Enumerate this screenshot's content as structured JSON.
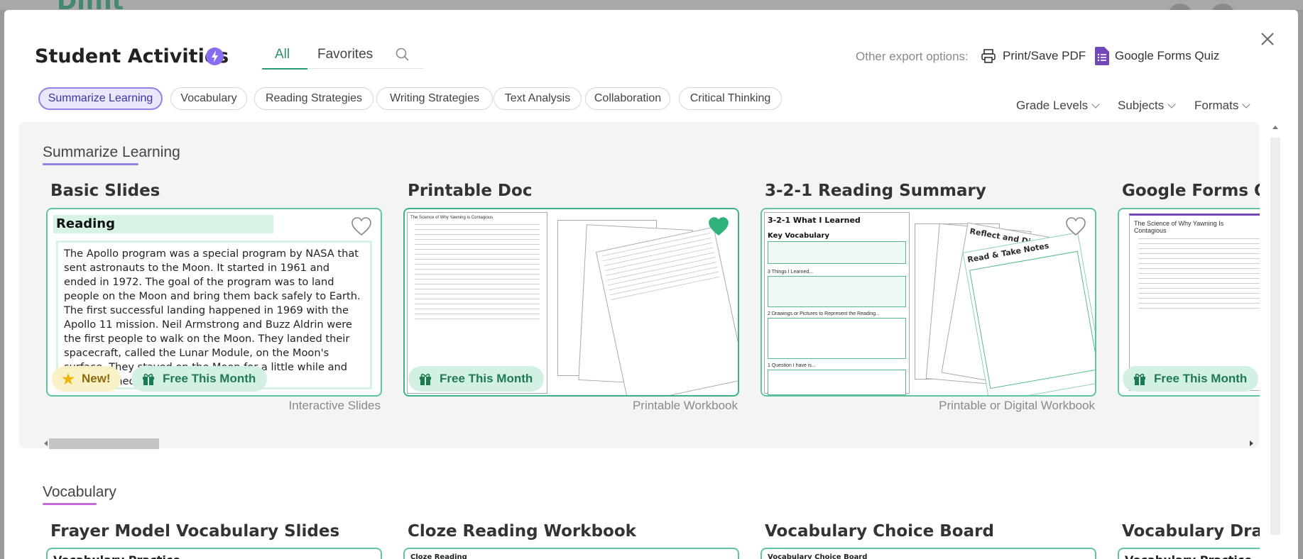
{
  "background": {
    "logo_text": "Diffit"
  },
  "header": {
    "title": "Student Activities",
    "tabs": [
      {
        "label": "All"
      },
      {
        "label": "Favorites"
      }
    ],
    "export": {
      "label": "Other export options:",
      "options": [
        {
          "label": "Print/Save PDF"
        },
        {
          "label": "Google Forms Quiz"
        }
      ]
    }
  },
  "categories": [
    {
      "label": "Summarize Learning"
    },
    {
      "label": "Vocabulary"
    },
    {
      "label": "Reading Strategies"
    },
    {
      "label": "Writing Strategies"
    },
    {
      "label": "Text Analysis"
    },
    {
      "label": "Collaboration"
    },
    {
      "label": "Critical Thinking"
    }
  ],
  "filters": [
    {
      "label": "Grade Levels"
    },
    {
      "label": "Subjects"
    },
    {
      "label": "Formats"
    }
  ],
  "sections": [
    {
      "title": "Summarize Learning",
      "cards": [
        {
          "title": "Basic Slides",
          "subtitle": "Interactive Slides",
          "preview_heading": "Reading",
          "preview_text": "The Apollo program was a special program by NASA that sent astronauts to the Moon. It started in 1961 and ended in 1972. The goal of the program was to land people on the Moon and bring them back safely to Earth. The first successful landing happened in 1969 with the Apollo 11 mission. Neil Armstrong and Buzz Aldrin were the first people to walk on the Moon. They landed their spacecraft, called the Lunar Module, on the Moon's surface. They stayed on the Moon for a little while and then returned to Earth.",
          "badge_new": "New!",
          "badge_free": "Free This Month",
          "favorited": false
        },
        {
          "title": "Printable Doc",
          "subtitle": "Printable Workbook",
          "preview_doc_title": "The Science of Why Yawning Is Contagious",
          "badge_free": "Free This Month",
          "favorited": true
        },
        {
          "title": "3-2-1 Reading Summary",
          "subtitle": "Printable or Digital Workbook",
          "preview_heading": "3-2-1 What I Learned",
          "preview_subheading": "Key Vocabulary",
          "preview_rows": [
            "3 Things I Learned...",
            "2 Drawings or Pictures to Represent the Reading...",
            "1 Question I have is..."
          ],
          "preview_stack": [
            "Reflect and Discuss",
            "Read & Take Notes"
          ],
          "favorited": false
        },
        {
          "title": "Google Forms Quiz",
          "subtitle": "",
          "preview_doc_title": "The Science of Why Yawning Is Contagious",
          "badge_free": "Free This Month",
          "favorited": false
        }
      ]
    },
    {
      "title": "Vocabulary",
      "cards": [
        {
          "title": "Frayer Model Vocabulary Slides",
          "preview_heading": "Vocabulary Practice"
        },
        {
          "title": "Cloze Reading Workbook",
          "preview_heading": "Cloze Reading"
        },
        {
          "title": "Vocabulary Choice Board",
          "preview_heading": "Vocabulary Choice Board"
        },
        {
          "title": "Vocabulary Drag",
          "preview_heading": "Vocabulary Practice"
        }
      ]
    }
  ],
  "colors": {
    "brand_green": "#2e9a70",
    "accent_purple": "#8a6cf0",
    "card_border": "#5fc59d",
    "badge_free_bg": "#d3f1e2",
    "badge_new_bg": "#fbf1c6"
  },
  "icons": {
    "close": "close-icon",
    "bolt": "lightning-bolt-icon",
    "search": "search-icon",
    "printer": "printer-icon",
    "forms": "google-forms-icon",
    "heart": "heart-icon",
    "gift": "gift-icon",
    "star": "star-icon"
  }
}
